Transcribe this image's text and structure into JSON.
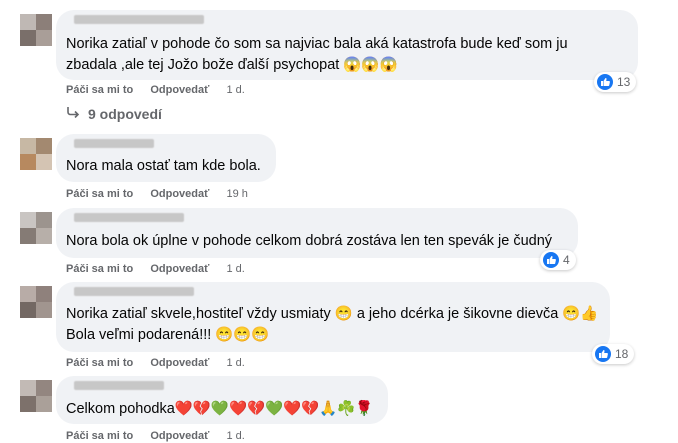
{
  "comments": [
    {
      "text_lines": [
        "Norika zatiaľ v pohode čo som sa najviac bala aká katastrofa bude keď som ju",
        "zbadala ,ale tej Jožo bože ďalší psychopat 😱😱😱"
      ],
      "reaction_count": "13",
      "like": "Páči sa mi to",
      "reply": "Odpovedať",
      "time": "1 d."
    },
    {
      "text_lines": [
        "Nora mala ostať tam kde bola."
      ],
      "reaction_count": "",
      "like": "Páči sa mi to",
      "reply": "Odpovedať",
      "time": "19 h"
    },
    {
      "text_lines": [
        "Nora bola ok úplne v pohode celkom dobrá zostáva len ten spevák je čudný"
      ],
      "reaction_count": "4",
      "like": "Páči sa mi to",
      "reply": "Odpovedať",
      "time": "1 d."
    },
    {
      "text_lines": [
        "Norika zatiaľ skvele,hostiteľ vždy usmiaty 😁 a jeho dcérka je šikovne dievča 😁👍",
        "Bola veľmi podarená!!! 😁😁😁"
      ],
      "reaction_count": "18",
      "like": "Páči sa mi to",
      "reply": "Odpovedať",
      "time": "1 d."
    },
    {
      "text_lines": [
        "Celkom pohodka❤️💔💚❤️💔💚❤️💔🙏☘️🌹"
      ],
      "reaction_count": "",
      "like": "Páči sa mi to",
      "reply": "Odpovedať",
      "time": "1 d."
    }
  ],
  "replies_link": "9 odpovedí",
  "colors": {
    "bubble": "#f0f2f5",
    "like_blue": "#1877f2",
    "meta": "#65676b"
  },
  "icons": {
    "like": "thumbs-up-icon",
    "reply_arrow": "reply-arrow-icon"
  }
}
